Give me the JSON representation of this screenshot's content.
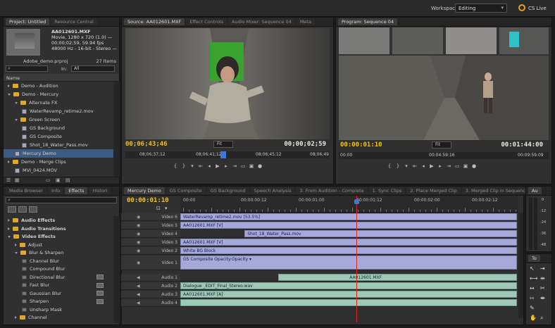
{
  "app": {
    "workspace_label": "Workspace:",
    "workspace_value": "Editing",
    "cs_live": "CS Live"
  },
  "project": {
    "tabs": [
      "Project: Untitled",
      "Resource Central"
    ],
    "clip_name": "AA012601.MXF",
    "clip_line1": "Movie, 1280 x 720 (1.0) —",
    "clip_line2": "00;00;02;59, 59.94 fps",
    "clip_line3": "48000 Hz - 16-bit - Stereo —",
    "file_name": "Adobe_demo.prproj",
    "item_count": "27 Items",
    "in_label": "In:",
    "in_value": "All",
    "name_header": "Name",
    "items": [
      {
        "label": "Demo - Audition",
        "type": "folder",
        "indent": 0,
        "open": false
      },
      {
        "label": "Demo - Mercury",
        "type": "folder",
        "indent": 0,
        "open": true
      },
      {
        "label": "Alternate FX",
        "type": "folder",
        "indent": 1,
        "open": true
      },
      {
        "label": "WaterRevamp_retime2.mov",
        "type": "clip",
        "indent": 2
      },
      {
        "label": "Green Screen",
        "type": "folder",
        "indent": 1,
        "open": true
      },
      {
        "label": "GS Background",
        "type": "clip",
        "indent": 2
      },
      {
        "label": "GS Composite",
        "type": "clip",
        "indent": 2
      },
      {
        "label": "Shot_18_Water_Pass.mov",
        "type": "clip",
        "indent": 2
      },
      {
        "label": "Mercury Demo",
        "type": "seq",
        "indent": 1
      },
      {
        "label": "Demo - Merge Clips",
        "type": "folder",
        "indent": 0,
        "open": false
      },
      {
        "label": "MVI_0424.MOV",
        "type": "clip",
        "indent": 1
      }
    ]
  },
  "source": {
    "tabs": [
      "Source: AA012601.MXF",
      "Effect Controls",
      "Audio Mixer: Sequence 04",
      "Meta"
    ],
    "timecode": "00;06;43;46",
    "fit": "Fit",
    "duration": "00;00;02;59",
    "ruler": [
      "08;06;37;12",
      "08;06;41;12",
      "08;06;45;12",
      "08;06;49"
    ]
  },
  "program": {
    "tab": "Program: Sequence 04",
    "timecode": "00:00:01:10",
    "fit": "Fit",
    "duration": "00:01:44:00",
    "ruler": [
      "00:00",
      "00:04:59:16",
      "00:09:59:09"
    ]
  },
  "effects": {
    "tabs": [
      "Media Browser",
      "Info",
      "Effects",
      "Histori"
    ],
    "items": [
      {
        "label": "Audio Effects",
        "type": "folder",
        "indent": 0,
        "bold": true
      },
      {
        "label": "Audio Transitions",
        "type": "folder",
        "indent": 0,
        "bold": true
      },
      {
        "label": "Video Effects",
        "type": "folder",
        "indent": 0,
        "bold": true,
        "open": true
      },
      {
        "label": "Adjust",
        "type": "folder",
        "indent": 1
      },
      {
        "label": "Blur & Sharpen",
        "type": "folder",
        "indent": 1,
        "open": true
      },
      {
        "label": "Channel Blur",
        "type": "fx",
        "indent": 2
      },
      {
        "label": "Compound Blur",
        "type": "fx",
        "indent": 2
      },
      {
        "label": "Directional Blur",
        "type": "fx",
        "indent": 2,
        "badge": true
      },
      {
        "label": "Fast Blur",
        "type": "fx",
        "indent": 2,
        "badge": true
      },
      {
        "label": "Gaussian Blur",
        "type": "fx",
        "indent": 2,
        "badge": true
      },
      {
        "label": "Sharpen",
        "type": "fx",
        "indent": 2,
        "badge": true
      },
      {
        "label": "Unsharp Mask",
        "type": "fx",
        "indent": 2
      },
      {
        "label": "Channel",
        "type": "folder",
        "indent": 1
      }
    ]
  },
  "timeline": {
    "tabs": [
      "Mercury Demo",
      "GS Composite",
      "GS Background",
      "Speech Analysis",
      "3. From Audition - Complete",
      "1. Sync Clips",
      "2. Place Merged Clip",
      "3. Merged Clip in Sequence"
    ],
    "timecode": "00:00:01:10",
    "ruler": [
      "00:00",
      "00:00:00:12",
      "00:00:01:00",
      "00:00:01:12",
      "00:00:02:00",
      "00:00:02:12"
    ],
    "tracks": [
      {
        "name": "Video 6",
        "kind": "video",
        "clips": [
          {
            "label": "WaterRevamp_retime2.mov [53.5%]",
            "start": 0,
            "end": 1
          }
        ]
      },
      {
        "name": "Video 5",
        "kind": "video",
        "clips": [
          {
            "label": "AA012601.MXF [V]",
            "start": 0,
            "end": 1
          }
        ]
      },
      {
        "name": "Video 4",
        "kind": "video",
        "clips": [
          {
            "label": "Shot_18_Water_Pass.mov",
            "start": 0.19,
            "end": 1
          }
        ]
      },
      {
        "name": "Video 3",
        "kind": "video",
        "clips": [
          {
            "label": "AA012601.MXF [V]",
            "start": 0,
            "end": 1
          }
        ]
      },
      {
        "name": "Video 2",
        "kind": "video",
        "clips": [
          {
            "label": "White BG Block",
            "start": 0,
            "end": 1
          }
        ]
      },
      {
        "name": "Video 1",
        "kind": "video",
        "tall": true,
        "clips": [
          {
            "label": "GS Composite  Opacity:Opacity ▾",
            "start": 0,
            "end": 1
          }
        ]
      },
      {
        "name": "Audio 1",
        "kind": "audio",
        "clips": [
          {
            "label": "AA012601.MXF",
            "start": 0.29,
            "end": 1
          }
        ]
      },
      {
        "name": "Audio 2",
        "kind": "audio",
        "clips": [
          {
            "label": "Dialogue _EDIT_Final_Stereo.wav",
            "start": 0,
            "end": 1
          }
        ]
      },
      {
        "name": "Audio 3",
        "kind": "audio",
        "clips": [
          {
            "label": "AA012601.MXF [A]",
            "start": 0,
            "end": 1
          }
        ]
      },
      {
        "name": "Audio 4",
        "kind": "audio",
        "clips": [
          {
            "label": "",
            "start": 0,
            "end": 1
          }
        ]
      }
    ],
    "playhead": 0.52
  },
  "audio_meter": {
    "label": "Au",
    "scale": [
      "0",
      "-12",
      "-24",
      "-36",
      "-48"
    ]
  },
  "tools": {
    "label": "To"
  }
}
